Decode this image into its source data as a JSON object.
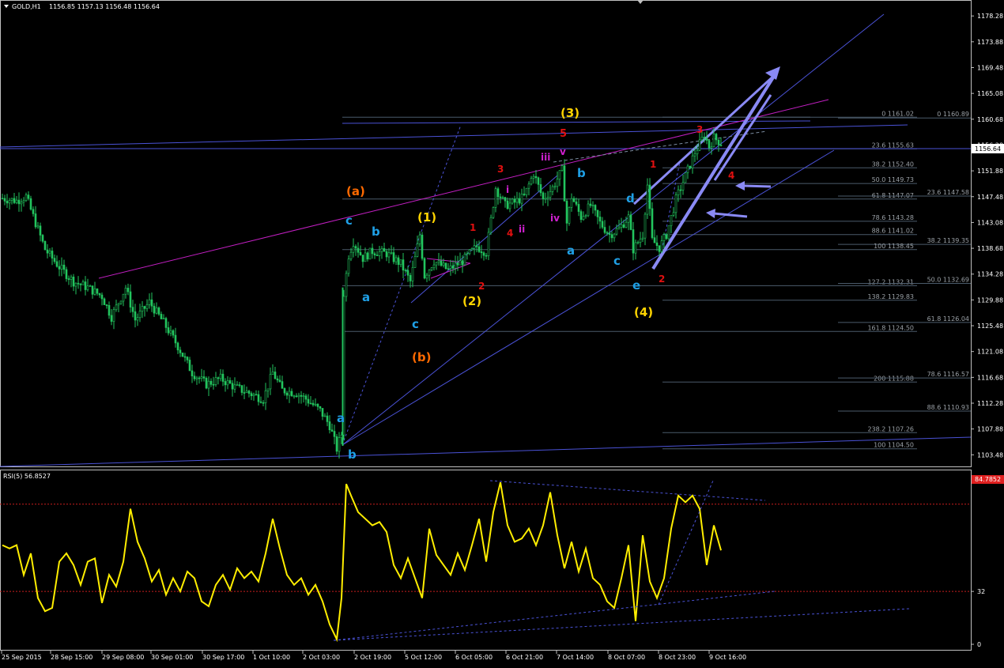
{
  "window": {
    "title": "GOLD,H1",
    "ohlc": "1156.85 1157.13 1156.48 1156.64",
    "current_price": "1156.64",
    "rsi_title": "RSI(5) 56.8527",
    "rsi_level_label": "84.7852"
  },
  "colors": {
    "background": "#000000",
    "axis": "#c0c0c0",
    "candles": "#22c55e",
    "rsi_line": "#ffee00",
    "trendline_blue": "#4a52d6",
    "trendline_magenta": "#c21fc2",
    "arrows": "#8a8af5",
    "fib_level": "#4b5b6b",
    "rsi_level": "#c81e1e"
  },
  "chart_data": [
    {
      "type": "candlestick",
      "title": "GOLD,H1",
      "y_ticks": [
        "1178.28",
        "1173.88",
        "1169.48",
        "1165.08",
        "1160.68",
        "1156.28",
        "1151.88",
        "1147.48",
        "1143.08",
        "1138.68",
        "1134.28",
        "1129.88",
        "1125.48",
        "1121.08",
        "1116.68",
        "1112.28",
        "1107.88",
        "1103.48"
      ],
      "y_range": [
        1101.5,
        1181.0
      ],
      "x_ticks": [
        "25 Sep 2015",
        "28 Sep 15:00",
        "29 Sep 08:00",
        "30 Sep 01:00",
        "30 Sep 17:00",
        "1 Oct 10:00",
        "2 Oct 03:00",
        "2 Oct 19:00",
        "5 Oct 12:00",
        "6 Oct 05:00",
        "6 Oct 21:00",
        "7 Oct 14:00",
        "8 Oct 07:00",
        "8 Oct 23:00",
        "9 Oct 16:00"
      ],
      "close_path": [
        {
          "bar": 0,
          "price": 1147.2
        },
        {
          "bar": 6,
          "price": 1146.8
        },
        {
          "bar": 10,
          "price": 1147.5
        },
        {
          "bar": 14,
          "price": 1143.0
        },
        {
          "bar": 18,
          "price": 1138.5
        },
        {
          "bar": 24,
          "price": 1135.5
        },
        {
          "bar": 30,
          "price": 1133.0
        },
        {
          "bar": 36,
          "price": 1132.0
        },
        {
          "bar": 42,
          "price": 1130.5
        },
        {
          "bar": 46,
          "price": 1127.0
        },
        {
          "bar": 52,
          "price": 1132.0
        },
        {
          "bar": 56,
          "price": 1126.5
        },
        {
          "bar": 62,
          "price": 1129.5
        },
        {
          "bar": 68,
          "price": 1126.0
        },
        {
          "bar": 74,
          "price": 1122.0
        },
        {
          "bar": 80,
          "price": 1117.5
        },
        {
          "bar": 86,
          "price": 1115.5
        },
        {
          "bar": 92,
          "price": 1116.5
        },
        {
          "bar": 98,
          "price": 1115.0
        },
        {
          "bar": 104,
          "price": 1114.0
        },
        {
          "bar": 110,
          "price": 1113.0
        },
        {
          "bar": 114,
          "price": 1117.5
        },
        {
          "bar": 118,
          "price": 1114.5
        },
        {
          "bar": 124,
          "price": 1114.0
        },
        {
          "bar": 128,
          "price": 1113.0
        },
        {
          "bar": 134,
          "price": 1111.0
        },
        {
          "bar": 138,
          "price": 1108.5
        },
        {
          "bar": 141,
          "price": 1104.5
        },
        {
          "bar": 143,
          "price": 1107.0
        },
        {
          "bar": 144,
          "price": 1131.0
        },
        {
          "bar": 146,
          "price": 1137.5
        },
        {
          "bar": 148,
          "price": 1139.8
        },
        {
          "bar": 152,
          "price": 1137.0
        },
        {
          "bar": 156,
          "price": 1138.2
        },
        {
          "bar": 162,
          "price": 1137.8
        },
        {
          "bar": 168,
          "price": 1136.0
        },
        {
          "bar": 172,
          "price": 1133.0
        },
        {
          "bar": 176,
          "price": 1141.0
        },
        {
          "bar": 178,
          "price": 1134.0
        },
        {
          "bar": 182,
          "price": 1136.5
        },
        {
          "bar": 188,
          "price": 1135.0
        },
        {
          "bar": 194,
          "price": 1136.5
        },
        {
          "bar": 200,
          "price": 1139.0
        },
        {
          "bar": 204,
          "price": 1138.0
        },
        {
          "bar": 208,
          "price": 1149.0
        },
        {
          "bar": 212,
          "price": 1146.0
        },
        {
          "bar": 216,
          "price": 1146.5
        },
        {
          "bar": 220,
          "price": 1147.5
        },
        {
          "bar": 224,
          "price": 1151.5
        },
        {
          "bar": 228,
          "price": 1147.0
        },
        {
          "bar": 232,
          "price": 1149.0
        },
        {
          "bar": 236,
          "price": 1152.0
        },
        {
          "bar": 238,
          "price": 1143.0
        },
        {
          "bar": 240,
          "price": 1147.5
        },
        {
          "bar": 244,
          "price": 1144.0
        },
        {
          "bar": 248,
          "price": 1146.0
        },
        {
          "bar": 252,
          "price": 1143.0
        },
        {
          "bar": 256,
          "price": 1141.0
        },
        {
          "bar": 260,
          "price": 1142.0
        },
        {
          "bar": 264,
          "price": 1144.0
        },
        {
          "bar": 266,
          "price": 1138.5
        },
        {
          "bar": 270,
          "price": 1141.0
        },
        {
          "bar": 272,
          "price": 1149.5
        },
        {
          "bar": 274,
          "price": 1140.0
        },
        {
          "bar": 277,
          "price": 1138.8
        },
        {
          "bar": 280,
          "price": 1141.0
        },
        {
          "bar": 284,
          "price": 1147.0
        },
        {
          "bar": 288,
          "price": 1151.0
        },
        {
          "bar": 292,
          "price": 1155.0
        },
        {
          "bar": 296,
          "price": 1158.0
        },
        {
          "bar": 298,
          "price": 1156.0
        },
        {
          "bar": 300,
          "price": 1157.5
        },
        {
          "bar": 303,
          "price": 1156.64
        }
      ],
      "fib_labels": [
        {
          "text": "0 1161.02",
          "price": 1161.02
        },
        {
          "text": "0 1160.89",
          "price": 1160.89
        },
        {
          "text": "23.6 1155.63",
          "price": 1155.63
        },
        {
          "text": "38.2 1152.40",
          "price": 1152.4
        },
        {
          "text": "50.0 1149.73",
          "price": 1149.73
        },
        {
          "text": "61.8 1147.07",
          "price": 1147.07
        },
        {
          "text": "23.6 1147.58",
          "price": 1147.58
        },
        {
          "text": "78.6 1143.28",
          "price": 1143.28
        },
        {
          "text": "88.6 1141.02",
          "price": 1141.02
        },
        {
          "text": "38.2 1139.35",
          "price": 1139.35
        },
        {
          "text": "100 1138.45",
          "price": 1138.45
        },
        {
          "text": "127.2 1132.31",
          "price": 1132.31
        },
        {
          "text": "50.0 1132.69",
          "price": 1132.69
        },
        {
          "text": "138.2 1129.83",
          "price": 1129.83
        },
        {
          "text": "61.8 1126.04",
          "price": 1126.04
        },
        {
          "text": "161.8 1124.50",
          "price": 1124.5
        },
        {
          "text": "200 1115.88",
          "price": 1115.88
        },
        {
          "text": "78.6 1116.57",
          "price": 1116.57
        },
        {
          "text": "88.6 1110.93",
          "price": 1110.93
        },
        {
          "text": "238.2 1107.26",
          "price": 1107.26
        },
        {
          "text": "100 1104.50",
          "price": 1104.5
        }
      ],
      "wave_labels": [
        "(a)",
        "c",
        "b",
        "a",
        "(b)",
        "a",
        "b",
        "(1)",
        "c",
        "(2)",
        "2",
        "1",
        "3",
        "4",
        "i",
        "ii",
        "iii",
        "iv",
        "v",
        "5",
        "(3)",
        "b",
        "a",
        "c",
        "d",
        "e",
        "2",
        "(4)",
        "1",
        "3",
        "4"
      ]
    },
    {
      "type": "line",
      "title": "RSI(5) 56.8527",
      "y_ticks": [
        "100",
        "32",
        "0"
      ],
      "y_range": [
        0,
        100
      ],
      "levels": [
        84.7852,
        32
      ],
      "series": [
        {
          "name": "RSI(5)",
          "values": [
            {
              "bar": 0,
              "value": 60
            },
            {
              "bar": 3,
              "value": 58
            },
            {
              "bar": 6,
              "value": 60
            },
            {
              "bar": 9,
              "value": 42
            },
            {
              "bar": 12,
              "value": 55
            },
            {
              "bar": 15,
              "value": 28
            },
            {
              "bar": 18,
              "value": 20
            },
            {
              "bar": 21,
              "value": 22
            },
            {
              "bar": 24,
              "value": 50
            },
            {
              "bar": 27,
              "value": 55
            },
            {
              "bar": 30,
              "value": 48
            },
            {
              "bar": 33,
              "value": 36
            },
            {
              "bar": 36,
              "value": 50
            },
            {
              "bar": 39,
              "value": 52
            },
            {
              "bar": 42,
              "value": 25
            },
            {
              "bar": 45,
              "value": 42
            },
            {
              "bar": 48,
              "value": 35
            },
            {
              "bar": 51,
              "value": 50
            },
            {
              "bar": 54,
              "value": 82
            },
            {
              "bar": 57,
              "value": 62
            },
            {
              "bar": 60,
              "value": 52
            },
            {
              "bar": 63,
              "value": 38
            },
            {
              "bar": 66,
              "value": 45
            },
            {
              "bar": 69,
              "value": 30
            },
            {
              "bar": 72,
              "value": 40
            },
            {
              "bar": 75,
              "value": 32
            },
            {
              "bar": 78,
              "value": 44
            },
            {
              "bar": 81,
              "value": 40
            },
            {
              "bar": 84,
              "value": 26
            },
            {
              "bar": 87,
              "value": 23
            },
            {
              "bar": 90,
              "value": 36
            },
            {
              "bar": 93,
              "value": 42
            },
            {
              "bar": 96,
              "value": 33
            },
            {
              "bar": 99,
              "value": 46
            },
            {
              "bar": 102,
              "value": 40
            },
            {
              "bar": 105,
              "value": 44
            },
            {
              "bar": 108,
              "value": 38
            },
            {
              "bar": 111,
              "value": 55
            },
            {
              "bar": 114,
              "value": 76
            },
            {
              "bar": 117,
              "value": 58
            },
            {
              "bar": 120,
              "value": 42
            },
            {
              "bar": 123,
              "value": 36
            },
            {
              "bar": 126,
              "value": 40
            },
            {
              "bar": 129,
              "value": 30
            },
            {
              "bar": 132,
              "value": 36
            },
            {
              "bar": 135,
              "value": 26
            },
            {
              "bar": 138,
              "value": 12
            },
            {
              "bar": 141,
              "value": 3
            },
            {
              "bar": 143,
              "value": 28
            },
            {
              "bar": 145,
              "value": 97
            },
            {
              "bar": 147,
              "value": 90
            },
            {
              "bar": 150,
              "value": 80
            },
            {
              "bar": 153,
              "value": 76
            },
            {
              "bar": 156,
              "value": 72
            },
            {
              "bar": 159,
              "value": 74
            },
            {
              "bar": 162,
              "value": 68
            },
            {
              "bar": 165,
              "value": 48
            },
            {
              "bar": 168,
              "value": 40
            },
            {
              "bar": 171,
              "value": 52
            },
            {
              "bar": 174,
              "value": 40
            },
            {
              "bar": 177,
              "value": 28
            },
            {
              "bar": 180,
              "value": 70
            },
            {
              "bar": 183,
              "value": 54
            },
            {
              "bar": 186,
              "value": 48
            },
            {
              "bar": 189,
              "value": 42
            },
            {
              "bar": 192,
              "value": 55
            },
            {
              "bar": 195,
              "value": 45
            },
            {
              "bar": 198,
              "value": 60
            },
            {
              "bar": 201,
              "value": 76
            },
            {
              "bar": 204,
              "value": 50
            },
            {
              "bar": 207,
              "value": 80
            },
            {
              "bar": 210,
              "value": 98
            },
            {
              "bar": 213,
              "value": 72
            },
            {
              "bar": 216,
              "value": 62
            },
            {
              "bar": 219,
              "value": 64
            },
            {
              "bar": 222,
              "value": 70
            },
            {
              "bar": 225,
              "value": 60
            },
            {
              "bar": 228,
              "value": 72
            },
            {
              "bar": 231,
              "value": 92
            },
            {
              "bar": 234,
              "value": 66
            },
            {
              "bar": 237,
              "value": 46
            },
            {
              "bar": 240,
              "value": 62
            },
            {
              "bar": 243,
              "value": 44
            },
            {
              "bar": 246,
              "value": 58
            },
            {
              "bar": 249,
              "value": 40
            },
            {
              "bar": 252,
              "value": 36
            },
            {
              "bar": 255,
              "value": 26
            },
            {
              "bar": 258,
              "value": 22
            },
            {
              "bar": 261,
              "value": 40
            },
            {
              "bar": 264,
              "value": 60
            },
            {
              "bar": 267,
              "value": 14
            },
            {
              "bar": 270,
              "value": 66
            },
            {
              "bar": 273,
              "value": 38
            },
            {
              "bar": 276,
              "value": 28
            },
            {
              "bar": 279,
              "value": 40
            },
            {
              "bar": 282,
              "value": 70
            },
            {
              "bar": 285,
              "value": 90
            },
            {
              "bar": 288,
              "value": 86
            },
            {
              "bar": 291,
              "value": 90
            },
            {
              "bar": 294,
              "value": 82
            },
            {
              "bar": 297,
              "value": 48
            },
            {
              "bar": 300,
              "value": 72
            },
            {
              "bar": 303,
              "value": 56.85
            }
          ]
        }
      ]
    }
  ]
}
